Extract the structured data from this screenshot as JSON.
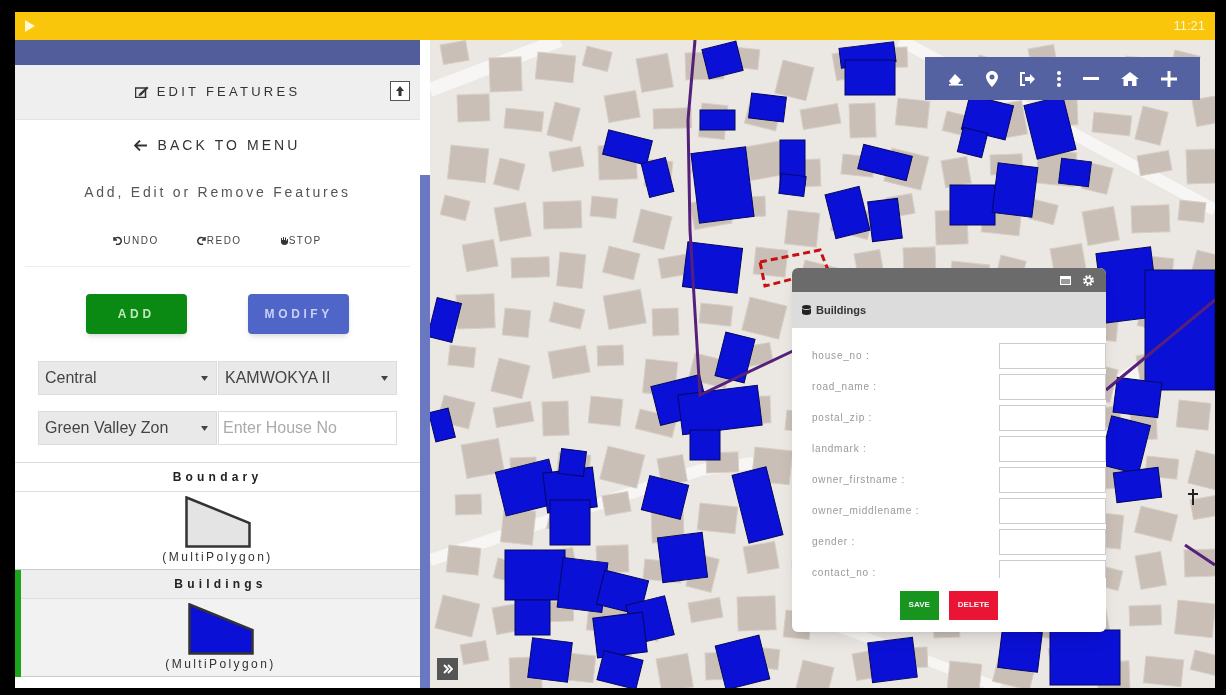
{
  "status_bar": {
    "time": "11:21"
  },
  "sidebar": {
    "section_title": "EDIT FEATURES",
    "back_link": "BACK TO MENU",
    "subtitle": "Add, Edit or Remove Features",
    "history_actions": [
      {
        "kind": "undo",
        "label": "UNDO"
      },
      {
        "kind": "redo",
        "label": "REDO"
      },
      {
        "kind": "stop",
        "label": "STOP"
      }
    ],
    "mode_buttons": [
      {
        "kind": "add",
        "label": "ADD"
      },
      {
        "kind": "modify",
        "label": "MODIFY"
      }
    ],
    "filters": [
      {
        "kind": "select",
        "value": "Central"
      },
      {
        "kind": "select",
        "value": "KAMWOKYA II"
      },
      {
        "kind": "select",
        "value": "Green Valley Zon"
      },
      {
        "kind": "input",
        "placeholder": "Enter House No"
      }
    ],
    "layers": [
      {
        "name": "Boundary",
        "geometry": "(MultiPolygon)",
        "color": "#e4e4e4",
        "selected": false
      },
      {
        "name": "Buildings",
        "geometry": "(MultiPolygon)",
        "color": "#0b10d6",
        "selected": true
      }
    ]
  },
  "popup": {
    "title": "Buildings",
    "fields": [
      {
        "label": "house_no :"
      },
      {
        "label": "road_name :"
      },
      {
        "label": "postal_zip :"
      },
      {
        "label": "landmark :"
      },
      {
        "label": "owner_firstname :"
      },
      {
        "label": "owner_middlename :"
      },
      {
        "label": "gender :"
      },
      {
        "label": "contact_no :"
      }
    ],
    "buttons": [
      {
        "kind": "save",
        "label": "SAVE"
      },
      {
        "kind": "delete",
        "label": "DELETE"
      }
    ]
  }
}
